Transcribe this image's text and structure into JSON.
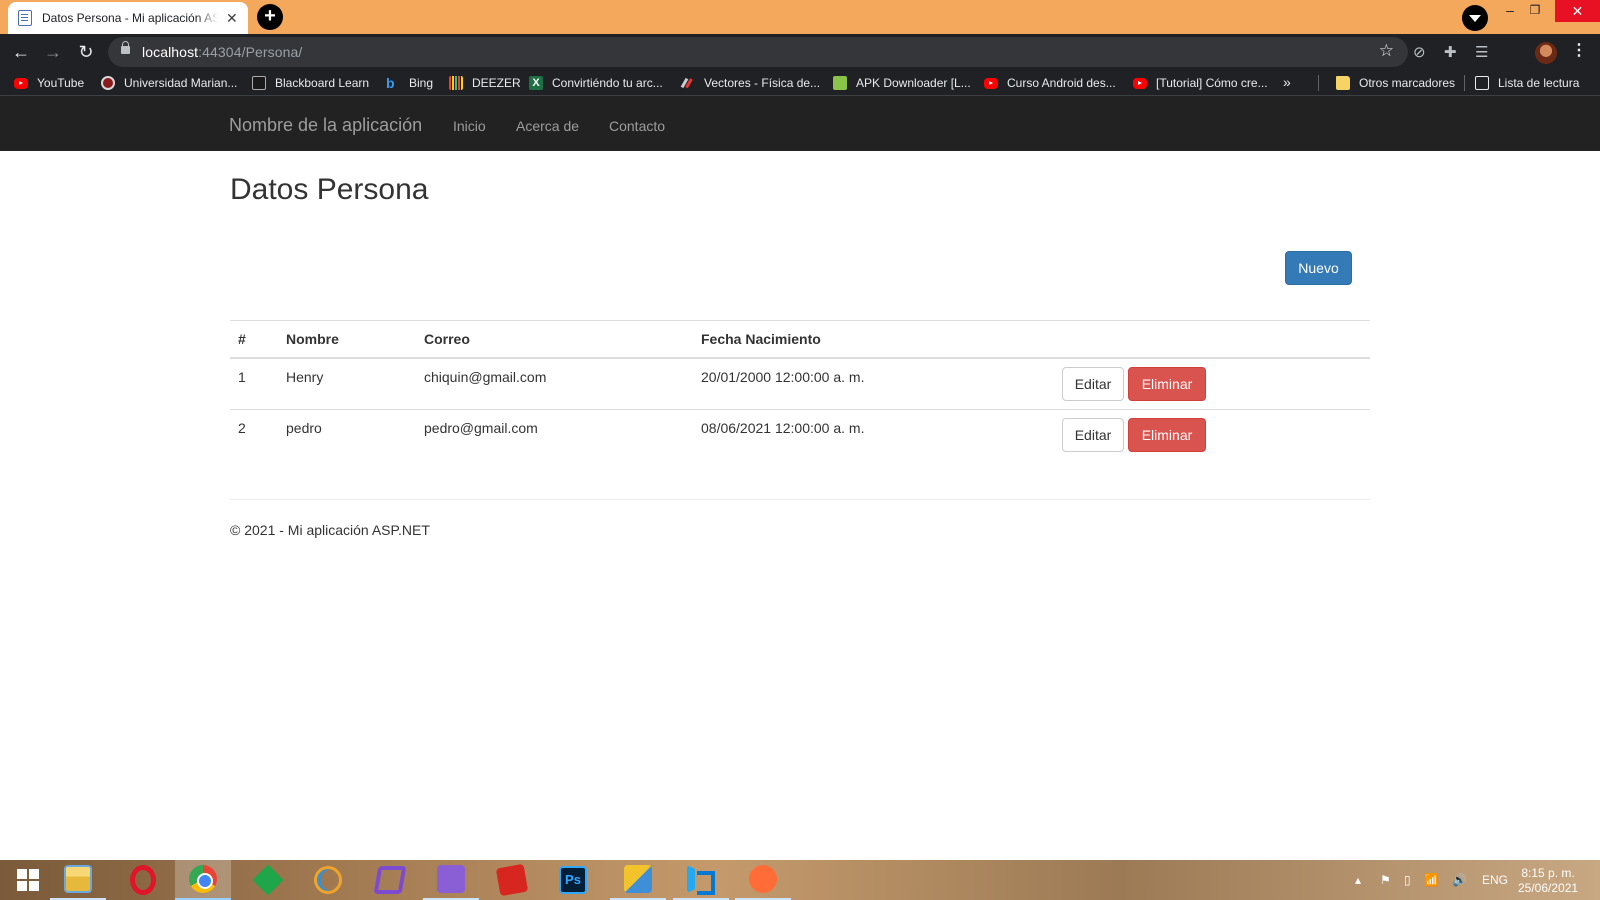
{
  "browser": {
    "tab_title": "Datos Persona - Mi aplicación ASP.NET",
    "tab_close": "✕",
    "new_tab": "+",
    "url_host": "localhost",
    "url_rest": ":44304/Persona/",
    "bookmarks": [
      {
        "label": "YouTube",
        "icon": "youtube-icon"
      },
      {
        "label": "Universidad Marian...",
        "icon": "university-icon"
      },
      {
        "label": "Blackboard Learn",
        "icon": "blackboard-icon"
      },
      {
        "label": "Bing",
        "icon": "bing-icon"
      },
      {
        "label": "DEEZER",
        "icon": "deezer-icon"
      },
      {
        "label": "Convirtiéndo tu arc...",
        "icon": "excel-icon"
      },
      {
        "label": "Vectores - Física de...",
        "icon": "vectors-icon"
      },
      {
        "label": "APK Downloader [L...",
        "icon": "apk-icon"
      },
      {
        "label": "Curso Android des...",
        "icon": "youtube-icon"
      },
      {
        "label": "[Tutorial] Cómo cre...",
        "icon": "youtube-icon"
      }
    ],
    "bookmarks_more": "»",
    "other_bookmarks": "Otros marcadores",
    "reading_list": "Lista de lectura"
  },
  "navbar": {
    "brand": "Nombre de la aplicación",
    "links": [
      "Inicio",
      "Acerca de",
      "Contacto"
    ]
  },
  "page": {
    "title": "Datos Persona",
    "new_button": "Nuevo",
    "table": {
      "headers": [
        "#",
        "Nombre",
        "Correo",
        "Fecha Nacimiento"
      ],
      "rows": [
        {
          "id": "1",
          "nombre": "Henry",
          "correo": "chiquin@gmail.com",
          "fecha": "20/01/2000 12:00:00 a. m."
        },
        {
          "id": "2",
          "nombre": "pedro",
          "correo": "pedro@gmail.com",
          "fecha": "08/06/2021 12:00:00 a. m."
        }
      ],
      "edit_label": "Editar",
      "delete_label": "Eliminar"
    },
    "footer": "© 2021 - Mi aplicación ASP.NET"
  },
  "taskbar": {
    "ps_label": "Ps",
    "language": "ENG",
    "time": "8:15 p. m.",
    "date": "25/06/2021"
  },
  "colors": {
    "tabstrip": "#f3a85b",
    "navbar": "#222222",
    "primary": "#337ab7",
    "danger": "#d9534f"
  }
}
